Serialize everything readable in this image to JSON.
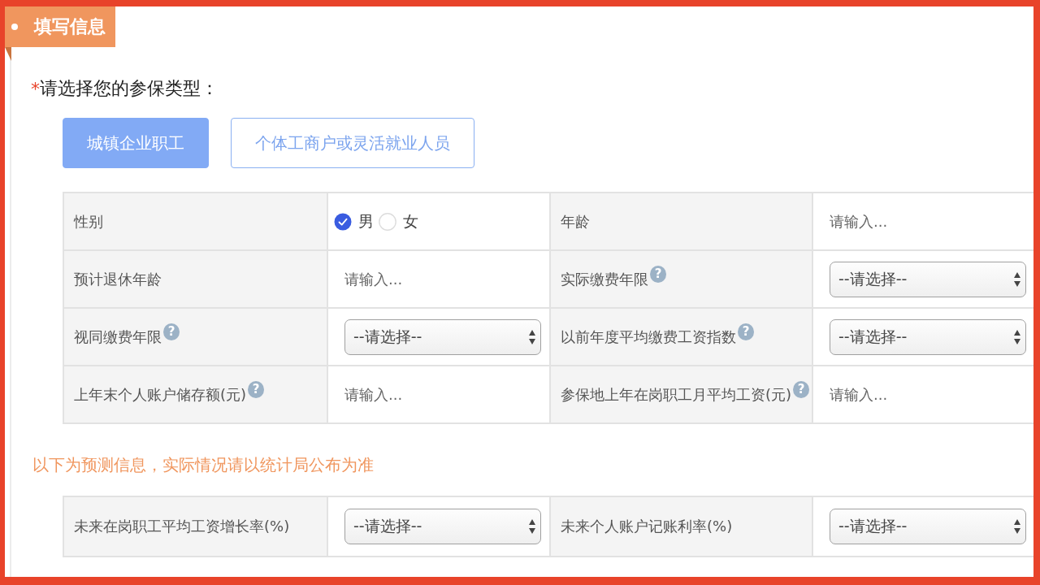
{
  "section": {
    "title": "填写信息"
  },
  "insurance_type": {
    "required_mark": "*",
    "label": "请选择您的参保类型：",
    "options": [
      {
        "label": "城镇企业职工",
        "selected": true
      },
      {
        "label": "个体工商户或灵活就业人员",
        "selected": false
      }
    ]
  },
  "basic_table": {
    "fields": [
      {
        "label": "性别",
        "kind": "radio",
        "options": [
          {
            "label": "男",
            "selected": true
          },
          {
            "label": "女",
            "selected": false
          }
        ]
      },
      {
        "label": "年龄",
        "kind": "input",
        "placeholder": "请输入..."
      },
      {
        "label": "预计退休年龄",
        "kind": "input",
        "placeholder": "请输入..."
      },
      {
        "label": "实际缴费年限",
        "help": "?",
        "kind": "select",
        "value": "--请选择--"
      },
      {
        "label": "视同缴费年限",
        "help": "?",
        "kind": "select",
        "value": "--请选择--"
      },
      {
        "label": "以前年度平均缴费工资指数",
        "help": "?",
        "kind": "select",
        "value": "--请选择--"
      },
      {
        "label": "上年末个人账户储存额(元)",
        "help": "?",
        "kind": "input",
        "placeholder": "请输入..."
      },
      {
        "label": "参保地上年在岗职工月平均工资(元)",
        "help": "?",
        "kind": "input",
        "placeholder": "请输入..."
      }
    ]
  },
  "forecast_note": "以下为预测信息，实际情况请以统计局公布为准",
  "forecast_table": {
    "fields": [
      {
        "label": "未来在岗职工平均工资增长率(%)",
        "kind": "select",
        "value": "--请选择--"
      },
      {
        "label": "未来个人账户记账利率(%)",
        "kind": "select",
        "value": "--请选择--"
      }
    ]
  }
}
